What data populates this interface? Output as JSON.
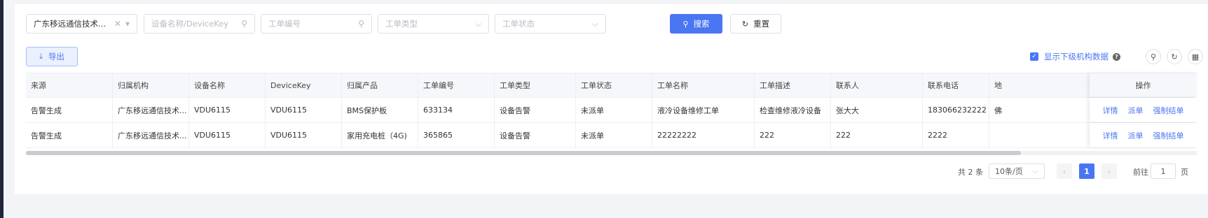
{
  "filters": {
    "org": {
      "value": "广东移远通信技术有限...",
      "clear_icon": "clear-icon",
      "arrow_icon": "chevron-down-icon"
    },
    "device": {
      "placeholder": "设备名称/DeviceKey",
      "icon": "search-icon"
    },
    "order_no": {
      "placeholder": "工单编号",
      "icon": "search-icon"
    },
    "order_type": {
      "placeholder": "工单类型",
      "icon": "chevron-down-icon"
    },
    "order_status": {
      "placeholder": "工单状态",
      "icon": "chevron-down-icon"
    }
  },
  "buttons": {
    "search": "搜索",
    "reset": "重置",
    "export": "导出"
  },
  "toggle": {
    "label": "显示下级机构数据",
    "checked": true
  },
  "table": {
    "columns": [
      "来源",
      "归属机构",
      "设备名称",
      "DeviceKey",
      "归属产品",
      "工单编号",
      "工单类型",
      "工单状态",
      "工单名称",
      "工单描述",
      "联系人",
      "联系电话",
      "地",
      "操作"
    ],
    "rows": [
      [
        "告警生成",
        "广东移远通信技术...",
        "VDU6115",
        "VDU6115",
        "BMS保护板",
        "633134",
        "设备告警",
        "未派单",
        "液冷设备维修工单",
        "检查维修液冷设备",
        "张大大",
        "183066232222",
        "佛"
      ],
      [
        "告警生成",
        "广东移远通信技术...",
        "VDU6115",
        "VDU6115",
        "家用充电桩（4G)",
        "365865",
        "设备告警",
        "未派单",
        "22222222",
        "222",
        "222",
        "2222",
        ""
      ]
    ],
    "actions": [
      "详情",
      "派单",
      "强制结单"
    ]
  },
  "pagination": {
    "total": "共 2 条",
    "page_size": "10条/页",
    "current": "1",
    "goto_prefix": "前往",
    "goto_value": "1",
    "goto_suffix": "页"
  },
  "colors": {
    "primary": "#4a76f2"
  }
}
